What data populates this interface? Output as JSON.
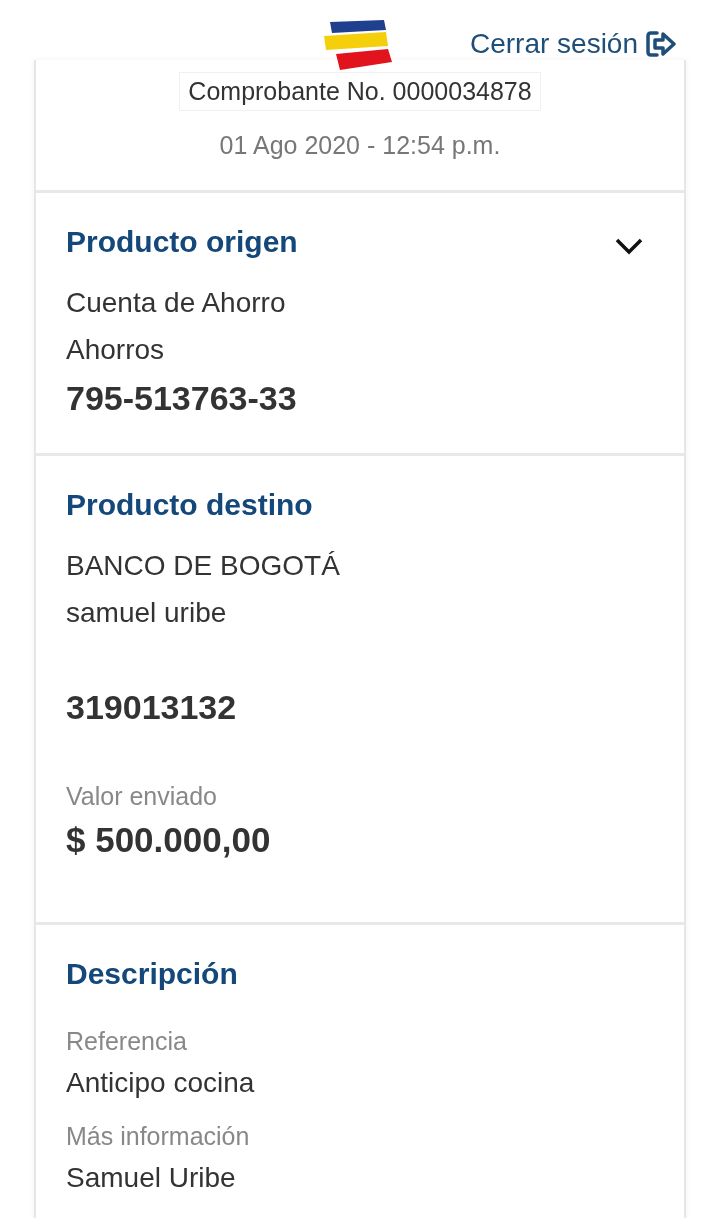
{
  "header": {
    "logout_label": "Cerrar sesión",
    "receipt_number": "Comprobante No. 0000034878",
    "date": "01 Ago 2020 - 12:54 p.m."
  },
  "sections": [
    {
      "kind": "origin",
      "title": "Producto origen",
      "collapsible": true,
      "lines": [
        {
          "kind": "plain",
          "text": "Cuenta de Ahorro"
        },
        {
          "kind": "plain",
          "text": "Ahorros"
        },
        {
          "kind": "number",
          "text": "795-513763-33"
        }
      ]
    },
    {
      "kind": "destination",
      "title": "Producto destino",
      "collapsible": false,
      "lines": [
        {
          "kind": "plain",
          "text": "BANCO DE BOGOTÁ"
        },
        {
          "kind": "plain",
          "text": "samuel uribe"
        },
        {
          "kind": "number",
          "text": "319013132"
        },
        {
          "kind": "caption",
          "text": "Valor enviado"
        },
        {
          "kind": "amount",
          "text": "$ 500.000,00"
        }
      ]
    },
    {
      "kind": "description",
      "title": "Descripción",
      "collapsible": false,
      "lines": [
        {
          "kind": "caption",
          "text": "Referencia"
        },
        {
          "kind": "plain",
          "text": "Anticipo cocina"
        },
        {
          "kind": "caption",
          "text": "Más información"
        },
        {
          "kind": "plain",
          "text": "Samuel Uribe"
        }
      ]
    }
  ]
}
